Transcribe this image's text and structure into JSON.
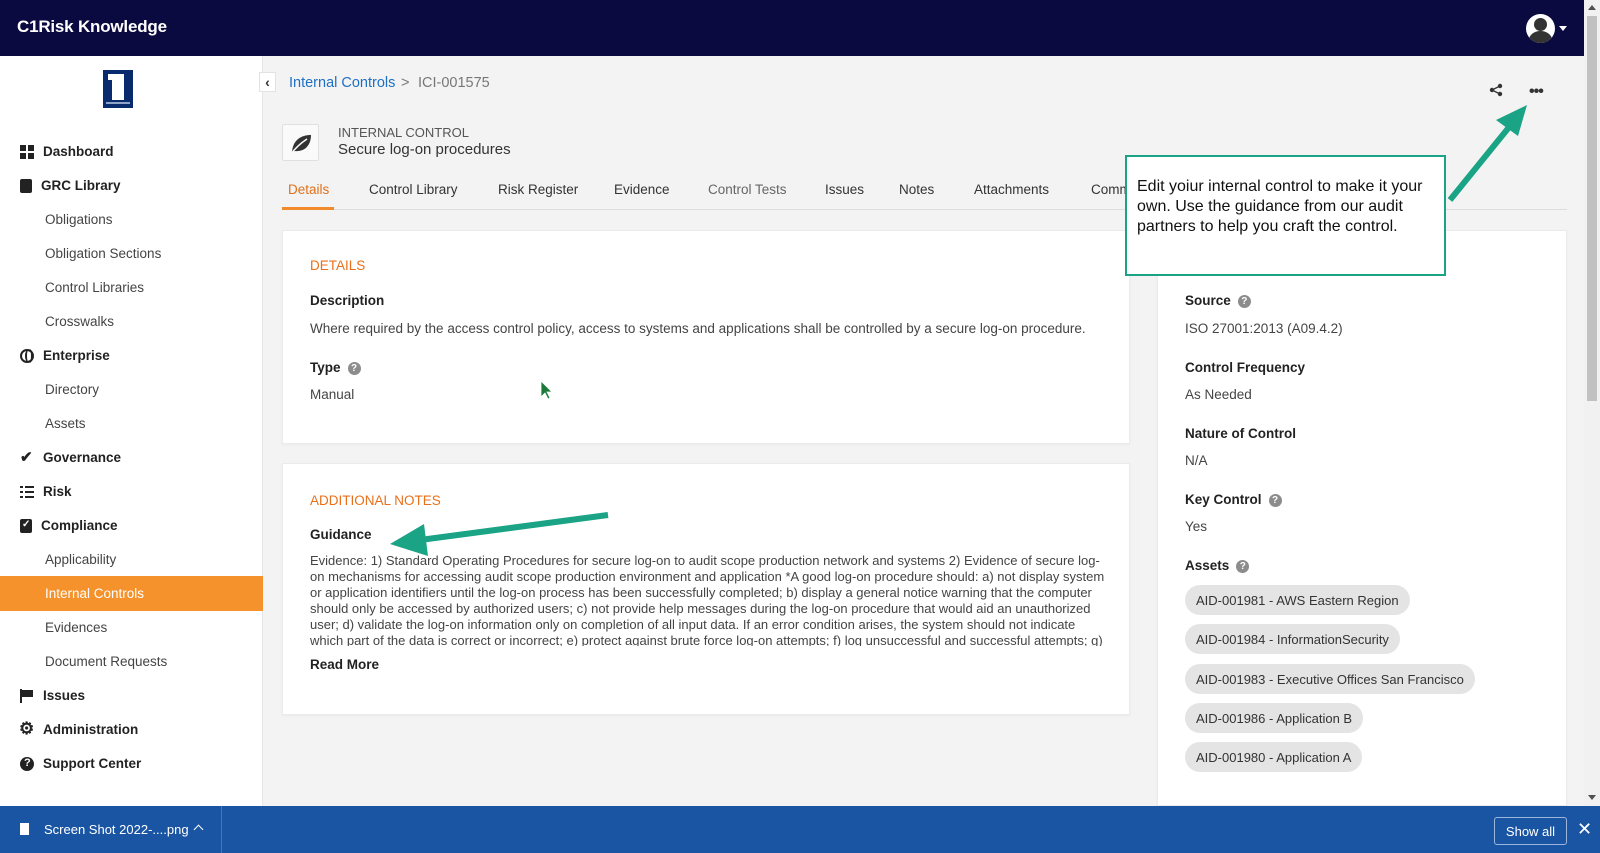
{
  "app": {
    "title": "C1Risk Knowledge"
  },
  "sidebar": {
    "items": [
      {
        "label": "Dashboard",
        "icon": "dashboard-icon",
        "level": "top"
      },
      {
        "label": "GRC Library",
        "icon": "book-icon",
        "level": "top"
      },
      {
        "label": "Obligations",
        "level": "sub"
      },
      {
        "label": "Obligation Sections",
        "level": "sub"
      },
      {
        "label": "Control Libraries",
        "level": "sub"
      },
      {
        "label": "Crosswalks",
        "level": "sub"
      },
      {
        "label": "Enterprise",
        "icon": "globe-icon",
        "level": "top"
      },
      {
        "label": "Directory",
        "level": "sub"
      },
      {
        "label": "Assets",
        "level": "sub"
      },
      {
        "label": "Governance",
        "icon": "check-icon",
        "level": "top"
      },
      {
        "label": "Risk",
        "icon": "list-icon",
        "level": "top"
      },
      {
        "label": "Compliance",
        "icon": "clipboard-icon",
        "level": "top"
      },
      {
        "label": "Applicability",
        "level": "sub"
      },
      {
        "label": "Internal Controls",
        "level": "sub",
        "active": true
      },
      {
        "label": "Evidences",
        "level": "sub"
      },
      {
        "label": "Document Requests",
        "level": "sub"
      },
      {
        "label": "Issues",
        "icon": "flag-icon",
        "level": "top"
      },
      {
        "label": "Administration",
        "icon": "gear-icon",
        "level": "top"
      },
      {
        "label": "Support Center",
        "icon": "help-icon",
        "level": "top"
      }
    ]
  },
  "breadcrumb": {
    "parent": "Internal Controls",
    "separator": ">",
    "current": "ICI-001575"
  },
  "record": {
    "type": "INTERNAL CONTROL",
    "name": "Secure log-on procedures"
  },
  "tabs": [
    "Details",
    "Control Library",
    "Risk Register",
    "Evidence",
    "Control Tests",
    "Issues",
    "Notes",
    "Attachments",
    "Comm"
  ],
  "details": {
    "section_title": "DETAILS",
    "description_label": "Description",
    "description": "Where required by the access control policy, access to systems and applications shall be controlled by a secure log-on procedure.",
    "type_label": "Type",
    "type": "Manual"
  },
  "notes": {
    "section_title": "ADDITIONAL NOTES",
    "guidance_label": "Guidance",
    "guidance": "Evidence: 1) Standard Operating Procedures for secure log-on to audit scope production network and systems 2) Evidence of secure log-on mechanisms for accessing audit scope production environment and application *A good log-on procedure should: a) not display system or application identifiers until the log-on process has been successfully completed; b) display a general notice warning that the computer should only be accessed by authorized users; c) not provide help messages during the log-on procedure that would aid an unauthorized user; d) validate the log-on information only on completion of all input data. If an error condition arises, the system should not indicate which part of the data is correct or incorrect; e) protect against brute force log-on attempts; f) log unsuccessful and successful attempts; g) raise a security",
    "read_more": "Read More"
  },
  "side_panel": {
    "source_label": "Source",
    "source": "ISO 27001:2013 (A09.4.2)",
    "frequency_label": "Control Frequency",
    "frequency": "As Needed",
    "nature_label": "Nature of Control",
    "nature": "N/A",
    "key_label": "Key Control",
    "key": "Yes",
    "assets_label": "Assets",
    "assets": [
      "AID-001981 - AWS Eastern Region",
      "AID-001984 - InformationSecurity",
      "AID-001983 - Executive Offices San Francisco",
      "AID-001986 - Application B",
      "AID-001980 - Application A"
    ]
  },
  "callout": {
    "text": "Edit yoiur internal control to make it your own. Use the guidance from our audit partners to help you craft the control."
  },
  "download_bar": {
    "file": "Screen Shot 2022-....png",
    "show_all": "Show all"
  },
  "colors": {
    "topbar": "#0a0a40",
    "accent": "#f5922b",
    "link": "#1f6fc5",
    "callout_border": "#1aa385",
    "download_bar": "#1a55a4"
  }
}
